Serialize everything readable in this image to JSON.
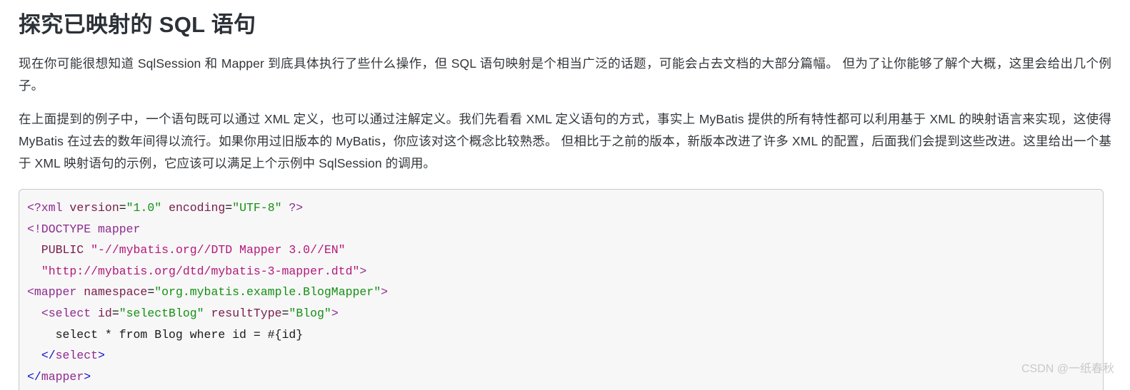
{
  "article": {
    "title": "探究已映射的 SQL 语句",
    "paragraphs": [
      "现在你可能很想知道 SqlSession 和 Mapper 到底具体执行了些什么操作，但 SQL 语句映射是个相当广泛的话题，可能会占去文档的大部分篇幅。 但为了让你能够了解个大概，这里会给出几个例子。",
      "在上面提到的例子中，一个语句既可以通过 XML 定义，也可以通过注解定义。我们先看看 XML 定义语句的方式，事实上 MyBatis 提供的所有特性都可以利用基于 XML 的映射语言来实现，这使得 MyBatis 在过去的数年间得以流行。如果你用过旧版本的 MyBatis，你应该对这个概念比较熟悉。 但相比于之前的版本，新版本改进了许多 XML 的配置，后面我们会提到这些改进。这里给出一个基于 XML 映射语句的示例，它应该可以满足上个示例中 SqlSession 的调用。"
    ]
  },
  "code": {
    "language": "xml",
    "plain_text": "<?xml version=\"1.0\" encoding=\"UTF-8\" ?>\n<!DOCTYPE mapper\n  PUBLIC \"-//mybatis.org//DTD Mapper 3.0//EN\"\n  \"http://mybatis.org/dtd/mybatis-3-mapper.dtd\">\n<mapper namespace=\"org.mybatis.example.BlogMapper\">\n  <select id=\"selectBlog\" resultType=\"Blog\">\n    select * from Blog where id = #{id}\n  </select>\n</mapper>",
    "lines": [
      {
        "tokens": [
          {
            "t": "<?xml",
            "c": "tag"
          },
          {
            "t": " ",
            "c": "plain"
          },
          {
            "t": "version",
            "c": "attr"
          },
          {
            "t": "=",
            "c": "plain"
          },
          {
            "t": "\"1.0\"",
            "c": "string"
          },
          {
            "t": " ",
            "c": "plain"
          },
          {
            "t": "encoding",
            "c": "attr"
          },
          {
            "t": "=",
            "c": "plain"
          },
          {
            "t": "\"UTF-8\"",
            "c": "string"
          },
          {
            "t": " ",
            "c": "plain"
          },
          {
            "t": "?>",
            "c": "tag"
          }
        ]
      },
      {
        "tokens": [
          {
            "t": "<!DOCTYPE",
            "c": "doctype"
          },
          {
            "t": " mapper",
            "c": "doctype"
          }
        ]
      },
      {
        "tokens": [
          {
            "t": "  PUBLIC",
            "c": "attr"
          },
          {
            "t": " ",
            "c": "plain"
          },
          {
            "t": "\"-//mybatis.org//DTD Mapper 3.0//EN\"",
            "c": "dstring"
          }
        ]
      },
      {
        "tokens": [
          {
            "t": "  ",
            "c": "plain"
          },
          {
            "t": "\"http://mybatis.org/dtd/mybatis-3-mapper.dtd\"",
            "c": "dstring"
          },
          {
            "t": ">",
            "c": "tag"
          }
        ]
      },
      {
        "tokens": [
          {
            "t": "<mapper",
            "c": "tag"
          },
          {
            "t": " ",
            "c": "plain"
          },
          {
            "t": "namespace",
            "c": "attr"
          },
          {
            "t": "=",
            "c": "plain"
          },
          {
            "t": "\"org.mybatis.example.BlogMapper\"",
            "c": "string"
          },
          {
            "t": ">",
            "c": "tag"
          }
        ]
      },
      {
        "tokens": [
          {
            "t": "  ",
            "c": "plain"
          },
          {
            "t": "<select",
            "c": "tag"
          },
          {
            "t": " ",
            "c": "plain"
          },
          {
            "t": "id",
            "c": "attr"
          },
          {
            "t": "=",
            "c": "plain"
          },
          {
            "t": "\"selectBlog\"",
            "c": "string"
          },
          {
            "t": " ",
            "c": "plain"
          },
          {
            "t": "resultType",
            "c": "attr"
          },
          {
            "t": "=",
            "c": "plain"
          },
          {
            "t": "\"Blog\"",
            "c": "string"
          },
          {
            "t": ">",
            "c": "tag"
          }
        ]
      },
      {
        "tokens": [
          {
            "t": "    select * from Blog where id = #{id}",
            "c": "plain"
          }
        ]
      },
      {
        "tokens": [
          {
            "t": "  ",
            "c": "plain"
          },
          {
            "t": "</",
            "c": "bracket"
          },
          {
            "t": "select",
            "c": "tag"
          },
          {
            "t": ">",
            "c": "bracket"
          }
        ]
      },
      {
        "tokens": [
          {
            "t": "</",
            "c": "bracket"
          },
          {
            "t": "mapper",
            "c": "tag"
          },
          {
            "t": ">",
            "c": "bracket"
          }
        ]
      }
    ]
  },
  "watermark": {
    "text": "CSDN @一纸春秋"
  },
  "colors": {
    "page_background": "#ffffff",
    "title": "#2b3137",
    "body_text": "#32363a",
    "code_background": "#f7f7f7",
    "code_border": "#c9c9c9",
    "tag": "#8e2a8e",
    "bracket": "#1010cf",
    "attribute": "#7a1b4a",
    "string": "#159015",
    "doctype_string": "#b3197a",
    "watermark": "#c9c9c9"
  }
}
